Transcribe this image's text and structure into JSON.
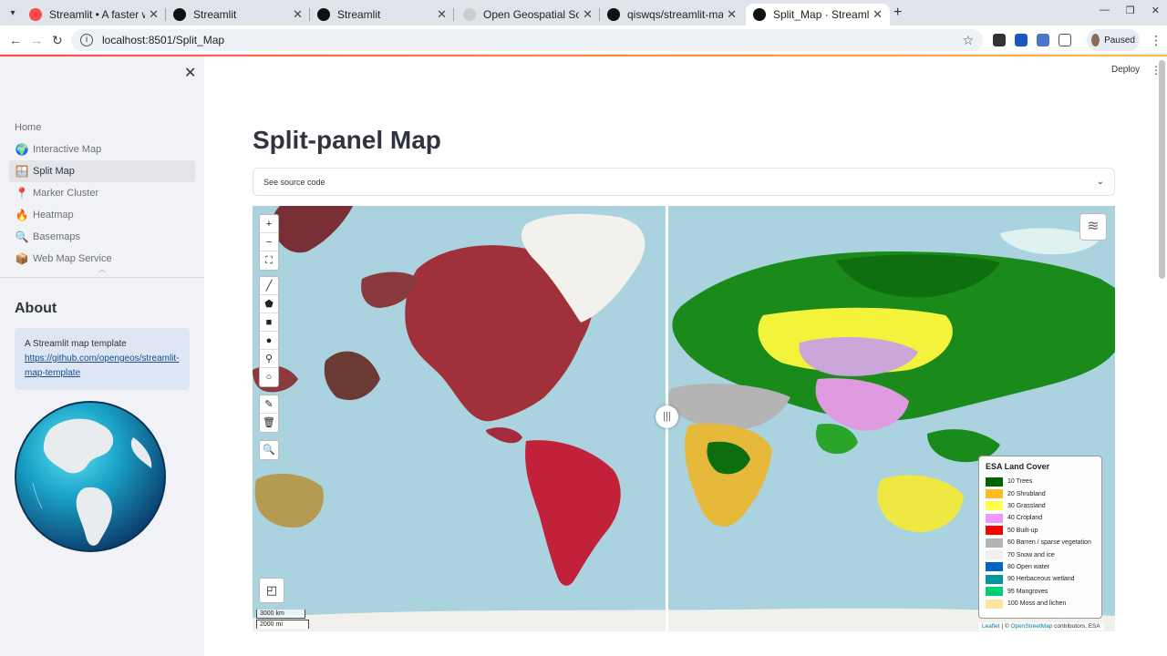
{
  "browser": {
    "tabs": [
      {
        "title": "Streamlit • A faster wa",
        "favicon_color": "#ff4b4b"
      },
      {
        "title": "Streamlit",
        "favicon_color": "#111111"
      },
      {
        "title": "Streamlit",
        "favicon_color": "#111111"
      },
      {
        "title": "Open Geospatial Solu",
        "favicon_color": "#cccccc"
      },
      {
        "title": "qiswqs/streamlit-map",
        "favicon_color": "#111111"
      },
      {
        "title": "Split_Map · Streamlit",
        "favicon_color": "#111111"
      }
    ],
    "new_tab_icon": "+",
    "url": "localhost:8501/Split_Map",
    "profile_label": "Paused"
  },
  "app": {
    "deploy_label": "Deploy",
    "sidebar": {
      "nav": [
        {
          "label": "Home",
          "icon": ""
        },
        {
          "label": "Interactive Map",
          "icon": "🌍"
        },
        {
          "label": "Split Map",
          "icon": "🪟"
        },
        {
          "label": "Marker Cluster",
          "icon": "📍"
        },
        {
          "label": "Heatmap",
          "icon": "🔥"
        },
        {
          "label": "Basemaps",
          "icon": "🔍"
        },
        {
          "label": "Web Map Service",
          "icon": "📦"
        }
      ],
      "about_title": "About",
      "about_text": "A Streamlit map template",
      "about_link": "https://github.com/opengeos/streamlit-map-template"
    },
    "main": {
      "title": "Split-panel Map",
      "expander_label": "See source code"
    },
    "map": {
      "scale_km": "3000 km",
      "scale_mi": "2000 mi",
      "legend": {
        "title": "ESA Land Cover",
        "items": [
          {
            "label": "10 Trees",
            "color": "#006400"
          },
          {
            "label": "20 Shrubland",
            "color": "#ffbb22"
          },
          {
            "label": "30 Grassland",
            "color": "#ffff4c"
          },
          {
            "label": "40 Cropland",
            "color": "#f096ff"
          },
          {
            "label": "50 Built-up",
            "color": "#fa0000"
          },
          {
            "label": "60 Barren / sparse vegetation",
            "color": "#b4b4b4"
          },
          {
            "label": "70 Snow and ice",
            "color": "#f0f0f0"
          },
          {
            "label": "80 Open water",
            "color": "#0064c8"
          },
          {
            "label": "90 Herbaceous wetland",
            "color": "#0096a0"
          },
          {
            "label": "95 Mangroves",
            "color": "#00cf75"
          },
          {
            "label": "100 Moss and lichen",
            "color": "#fae6a0"
          }
        ]
      },
      "attribution": {
        "leaflet": "Leaflet",
        "sep": " | © ",
        "osm": "OpenStreetMap",
        "rest": " contributors, ESA"
      }
    }
  }
}
